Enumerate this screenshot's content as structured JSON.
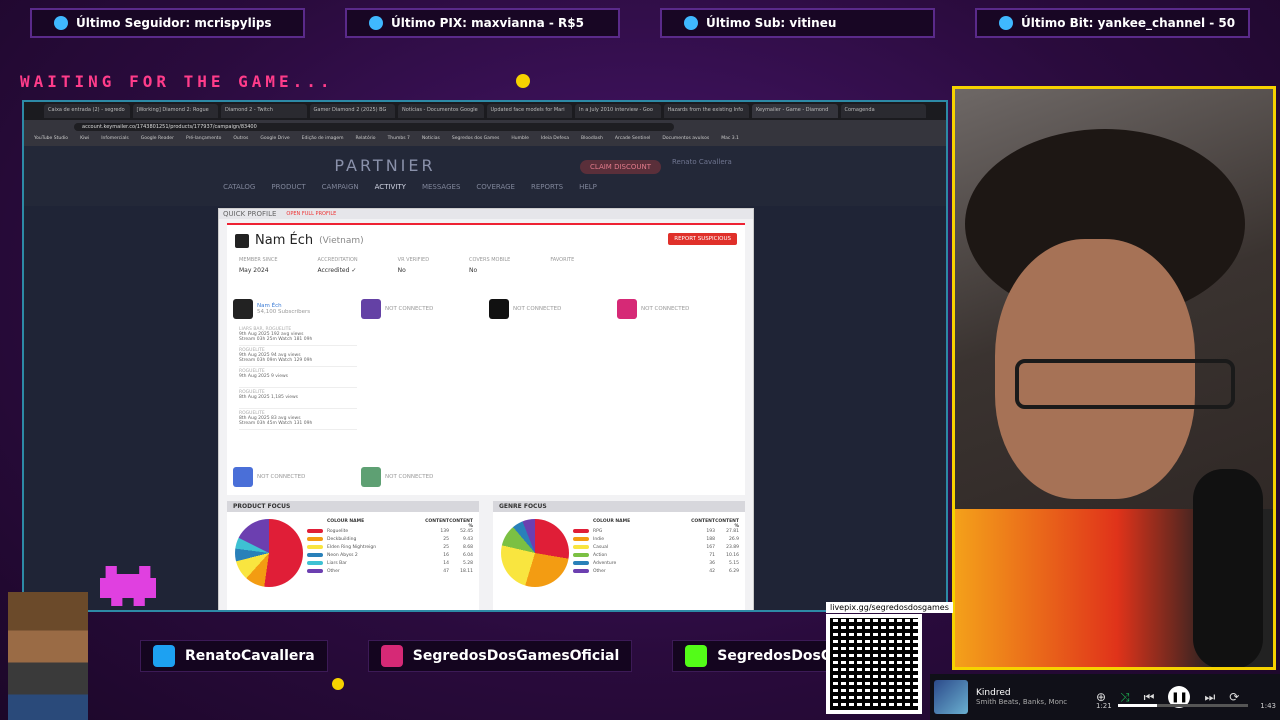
{
  "top_stats": [
    {
      "label": "Último Seguidor: mcrispylips",
      "icon": "user-icon"
    },
    {
      "label": "Último PIX: maxvianna - R$5",
      "icon": "dollar-icon"
    },
    {
      "label": "Último Sub: vitineu",
      "icon": "star-icon"
    },
    {
      "label": "Último Bit: yankee_channel - 50",
      "icon": "diamond-icon"
    }
  ],
  "waiting_text": "WAITING FOR THE GAME...",
  "browser": {
    "tabs": [
      "Caixa de entrada (2) - segredo",
      "[Working] Diamond 2: Rogue",
      "Diamond 2 - Twitch",
      "Gamer Diamond 2 (2025) BG",
      "Notícias - Documentos Google",
      "Updated face models for Mari",
      "In a July 2010 interview - Goo",
      "Hazards from the existing Info",
      "Keymailer - Game - Diamond",
      "Comagenda"
    ],
    "url": "account.keymailer.co/1743801251/products/177937/campaign/83400",
    "bookmarks": [
      "YouTube Studio",
      "Kiwi",
      "Infomercials",
      "Google Reader",
      "Pré-lançamento",
      "Outros",
      "Google Drive",
      "Edição de imagem",
      "Relatório",
      "Thumbs 7",
      "Notícias",
      "Segredos dos Games",
      "Humble",
      "Ideia Defesa",
      "Bloodlash",
      "Arcade Sentinel",
      "Documentos avulsos",
      "Mac 3.1"
    ]
  },
  "site": {
    "logo": "PARTNIER",
    "nav": [
      "CATALOG",
      "PRODUCT",
      "CAMPAIGN",
      "ACTIVITY",
      "MESSAGES",
      "COVERAGE",
      "REPORTS",
      "HELP"
    ],
    "active_nav": "ACTIVITY",
    "claim_label": "CLAIM DISCOUNT",
    "user_name": "Renato Cavallera"
  },
  "modal": {
    "title": "QUICK PROFILE",
    "open_full": "OPEN FULL PROFILE",
    "name": "Nam Éch",
    "country": "(Vietnam)",
    "report_label": "REPORT SUSPICIOUS",
    "meta": [
      {
        "label": "MEMBER SINCE",
        "value": "May 2024"
      },
      {
        "label": "ACCREDITATION",
        "value": "Accredited ✓"
      },
      {
        "label": "VR VERIFIED",
        "value": "No"
      },
      {
        "label": "COVERS MOBILE",
        "value": "No"
      },
      {
        "label": "FAVORITE",
        "value": ""
      }
    ],
    "socials": [
      {
        "name": "Nam Éch",
        "sub": "54,100 Subscribers",
        "icon": "youtube-icon"
      },
      {
        "name": "NOT CONNECTED",
        "sub": "",
        "icon": "twitch-icon"
      },
      {
        "name": "NOT CONNECTED",
        "sub": "",
        "icon": "tiktok-icon"
      },
      {
        "name": "NOT CONNECTED",
        "sub": "",
        "icon": "instagram-icon"
      }
    ],
    "streams": [
      {
        "title": "LIARS BAR, ROGUELITE",
        "line1": "9th Aug 2025    192 avg views",
        "line2": "Stream 03h 25m    Watch 181 09h"
      },
      {
        "title": "ROGUELITE",
        "line1": "9th Aug 2025    94 avg views",
        "line2": "Stream 03h 09m    Watch 129 09h"
      },
      {
        "title": "ROGUELITE",
        "line1": "9th Aug 2025    9 views",
        "line2": ""
      },
      {
        "title": "ROGUELITE",
        "line1": "8th Aug 2025    1,185 views",
        "line2": ""
      },
      {
        "title": "ROGUELITE",
        "line1": "8th Aug 2025    83 avg views",
        "line2": "Stream 03h 45m    Watch 131 09h"
      }
    ],
    "bottom_socials": [
      "NOT CONNECTED",
      "NOT CONNECTED"
    ]
  },
  "chart_data": [
    {
      "type": "pie",
      "title": "PRODUCT FOCUS",
      "columns": [
        "COLOUR",
        "NAME",
        "CONTENT",
        "CONTENT %"
      ],
      "categories": [
        "Roguelite",
        "Deckbuilding",
        "Elden Ring Nightreign",
        "Neon Abyss 2",
        "Liars Bar",
        "Other"
      ],
      "values": [
        139,
        25,
        25,
        16,
        14,
        47
      ],
      "percents": [
        "52.45",
        "9.43",
        "8.68",
        "6.04",
        "5.28",
        "18.11"
      ],
      "colors": [
        "#e01e37",
        "#f39c12",
        "#f9e53f",
        "#2980b9",
        "#3ec1d3",
        "#6c3fb0"
      ]
    },
    {
      "type": "pie",
      "title": "GENRE FOCUS",
      "columns": [
        "COLOUR",
        "NAME",
        "CONTENT",
        "CONTENT %"
      ],
      "categories": [
        "RPG",
        "Indie",
        "Casual",
        "Action",
        "Adventure",
        "Other"
      ],
      "values": [
        193,
        188,
        167,
        71,
        36,
        42
      ],
      "percents": [
        "27.81",
        "26.9",
        "23.89",
        "10.16",
        "5.15",
        "6.29"
      ],
      "colors": [
        "#e01e37",
        "#f39c12",
        "#f9e53f",
        "#7bc043",
        "#2980b9",
        "#6c3fb0"
      ]
    }
  ],
  "handles": [
    {
      "text": "RenatoCavallera",
      "icon": "twitter-icon",
      "color": "#1da1f2"
    },
    {
      "text": "SegredosDosGamesOficial",
      "icon": "instagram-icon",
      "color": "#d62976"
    },
    {
      "text": "SegredosDosGames",
      "icon": "kick-icon",
      "color": "#53fc18"
    }
  ],
  "qr_label": "livepix.gg/segredosdosgames",
  "player": {
    "title": "Kindred",
    "artist": "Smith Beats, Banks, Monc",
    "elapsed": "1:21",
    "total": "1:43",
    "progress": 0.3
  }
}
